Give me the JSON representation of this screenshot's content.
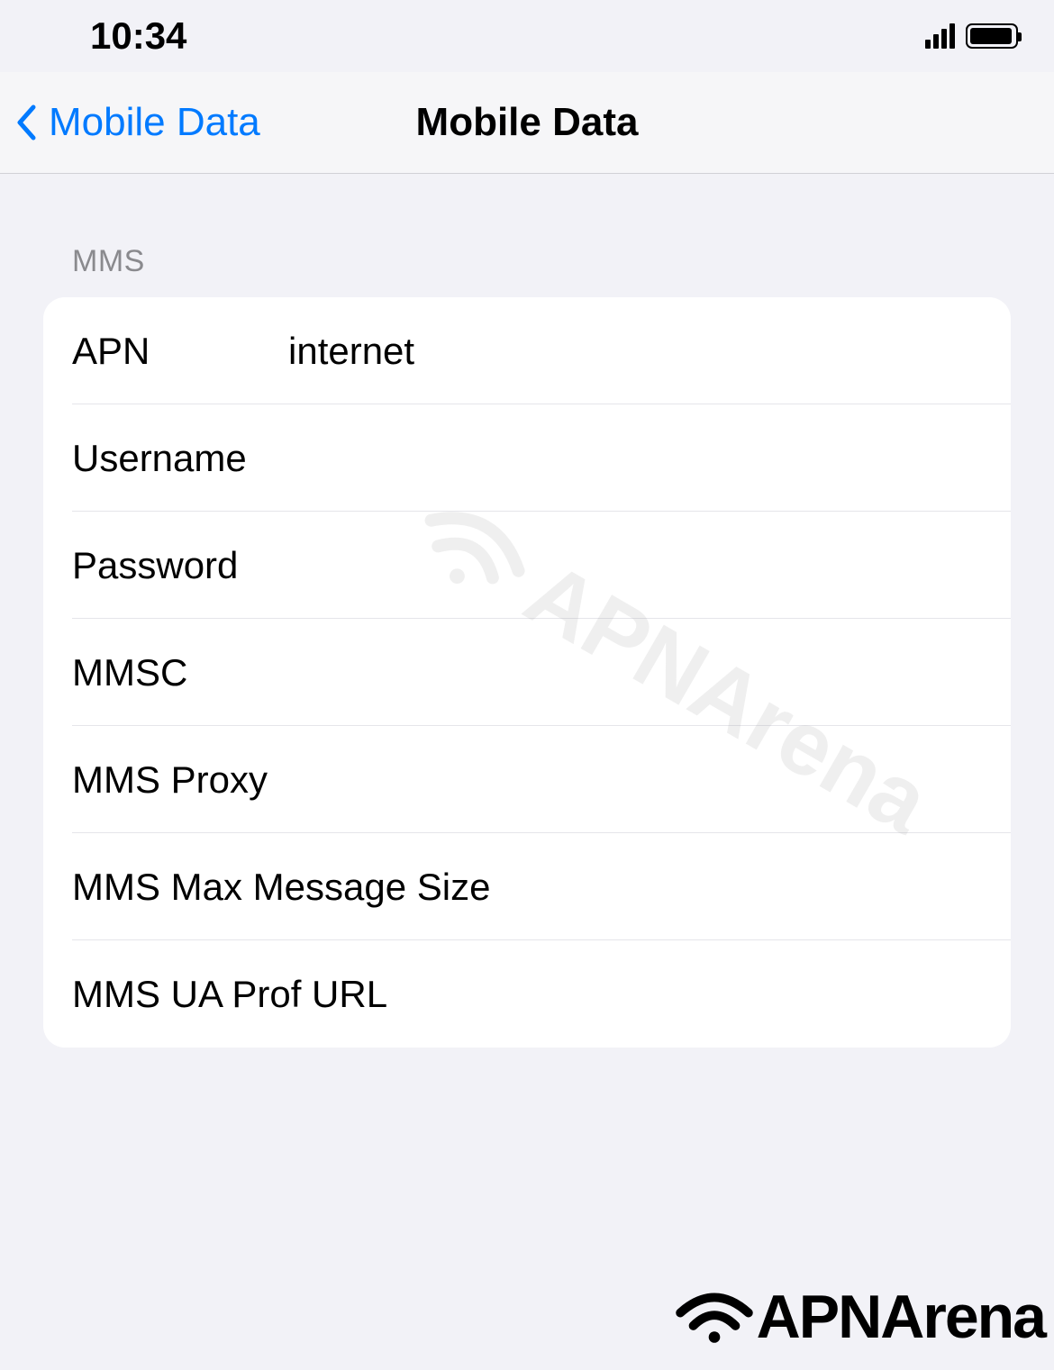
{
  "statusBar": {
    "time": "10:34"
  },
  "navBar": {
    "backLabel": "Mobile Data",
    "title": "Mobile Data"
  },
  "section": {
    "header": "MMS",
    "rows": [
      {
        "label": "APN",
        "value": "internet"
      },
      {
        "label": "Username",
        "value": ""
      },
      {
        "label": "Password",
        "value": ""
      },
      {
        "label": "MMSC",
        "value": ""
      },
      {
        "label": "MMS Proxy",
        "value": ""
      },
      {
        "label": "MMS Max Message Size",
        "value": ""
      },
      {
        "label": "MMS UA Prof URL",
        "value": ""
      }
    ]
  },
  "branding": {
    "watermark": "APNArena",
    "footer": "APNArena"
  }
}
